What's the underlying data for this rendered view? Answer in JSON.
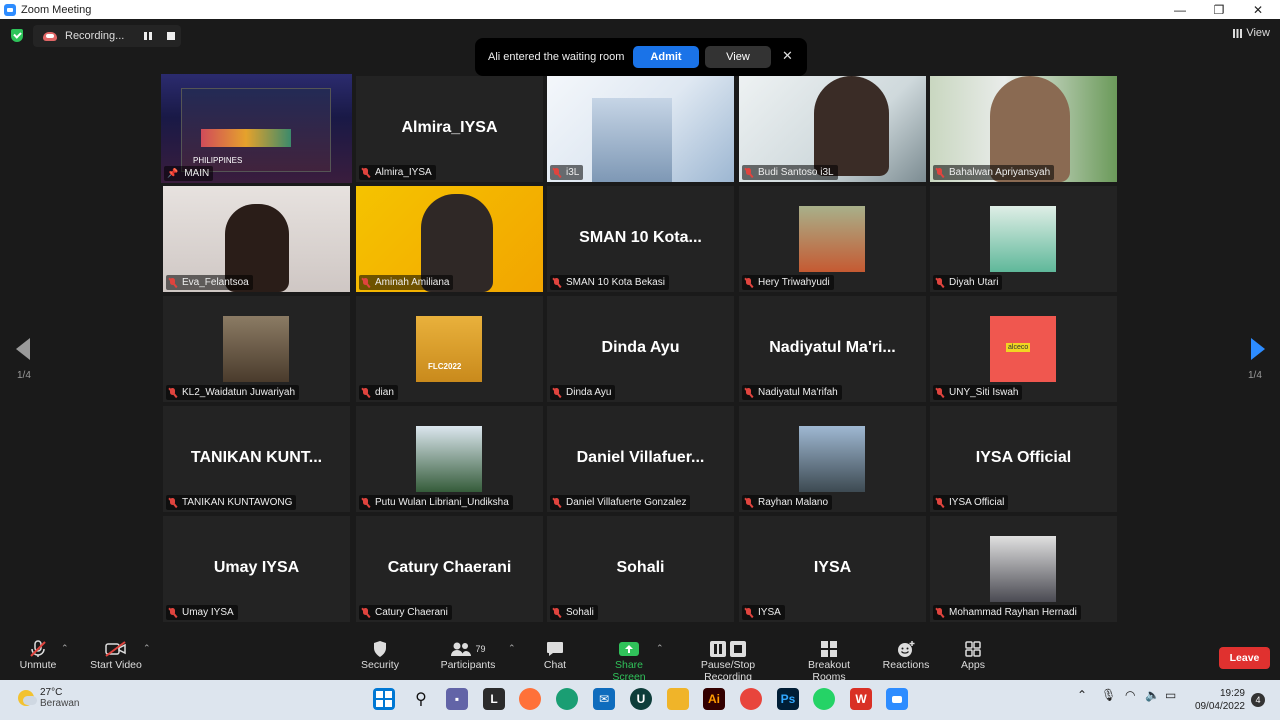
{
  "window": {
    "title": "Zoom Meeting",
    "minimize": "—",
    "maximize": "❐",
    "close": "✕"
  },
  "recording": {
    "label": "Recording..."
  },
  "notification": {
    "message": "Ali entered the waiting room",
    "admit": "Admit",
    "view": "View",
    "close": "✕"
  },
  "view_button": "View",
  "pagination": {
    "left": "1/4",
    "right": "1/4"
  },
  "tiles": [
    {
      "name": "MAIN",
      "big": "",
      "overlay": "PHILIPPINES"
    },
    {
      "name": "Almira_IYSA",
      "big": "Almira_IYSA"
    },
    {
      "name": "i3L",
      "big": ""
    },
    {
      "name": "Budi Santoso i3L",
      "big": ""
    },
    {
      "name": "Bahalwan Apriyansyah",
      "big": ""
    },
    {
      "name": "Eva_Felantsoa",
      "big": ""
    },
    {
      "name": "Aminah Amiliana",
      "big": ""
    },
    {
      "name": "SMAN 10 Kota Bekasi",
      "big": "SMAN  10  Kota..."
    },
    {
      "name": "Hery Triwahyudi",
      "big": ""
    },
    {
      "name": "Diyah Utari",
      "big": ""
    },
    {
      "name": "KL2_Waidatun Juwariyah",
      "big": ""
    },
    {
      "name": "dian",
      "big": "",
      "overlay": "FLC2022"
    },
    {
      "name": "Dinda Ayu",
      "big": "Dinda Ayu"
    },
    {
      "name": "Nadiyatul Ma'rifah",
      "big": "Nadiyatul  Ma'ri..."
    },
    {
      "name": "UNY_Siti Iswah",
      "big": "",
      "overlay": "alceco"
    },
    {
      "name": "TANIKAN KUNTAWONG",
      "big": "TANIKAN  KUNT..."
    },
    {
      "name": "Putu Wulan Libriani_Undiksha",
      "big": ""
    },
    {
      "name": "Daniel Villafuerte Gonzalez",
      "big": "Daniel  Villafuer..."
    },
    {
      "name": "Rayhan Malano",
      "big": ""
    },
    {
      "name": "IYSA Official",
      "big": "IYSA Official"
    },
    {
      "name": "Umay IYSA",
      "big": "Umay IYSA"
    },
    {
      "name": "Catury Chaerani",
      "big": "Catury Chaerani"
    },
    {
      "name": "Sohali",
      "big": "Sohali"
    },
    {
      "name": "IYSA",
      "big": "IYSA"
    },
    {
      "name": "Mohammad Rayhan Hernadi",
      "big": ""
    }
  ],
  "toolbar": {
    "unmute": "Unmute",
    "start_video": "Start Video",
    "security": "Security",
    "participants": "Participants",
    "participants_count": "79",
    "chat": "Chat",
    "share_screen": "Share Screen",
    "recording": "Pause/Stop Recording",
    "breakout": "Breakout Rooms",
    "reactions": "Reactions",
    "apps": "Apps",
    "leave": "Leave"
  },
  "taskbar": {
    "temperature": "27°C",
    "weather": "Berawan",
    "time": "19:29",
    "date": "09/04/2022",
    "notifications": "4"
  },
  "colors": {
    "accent": "#2d8cff",
    "muted_red": "#e0443e",
    "leave_red": "#e0312f",
    "share_green": "#30c25a",
    "active_border": "#d8e36a"
  }
}
